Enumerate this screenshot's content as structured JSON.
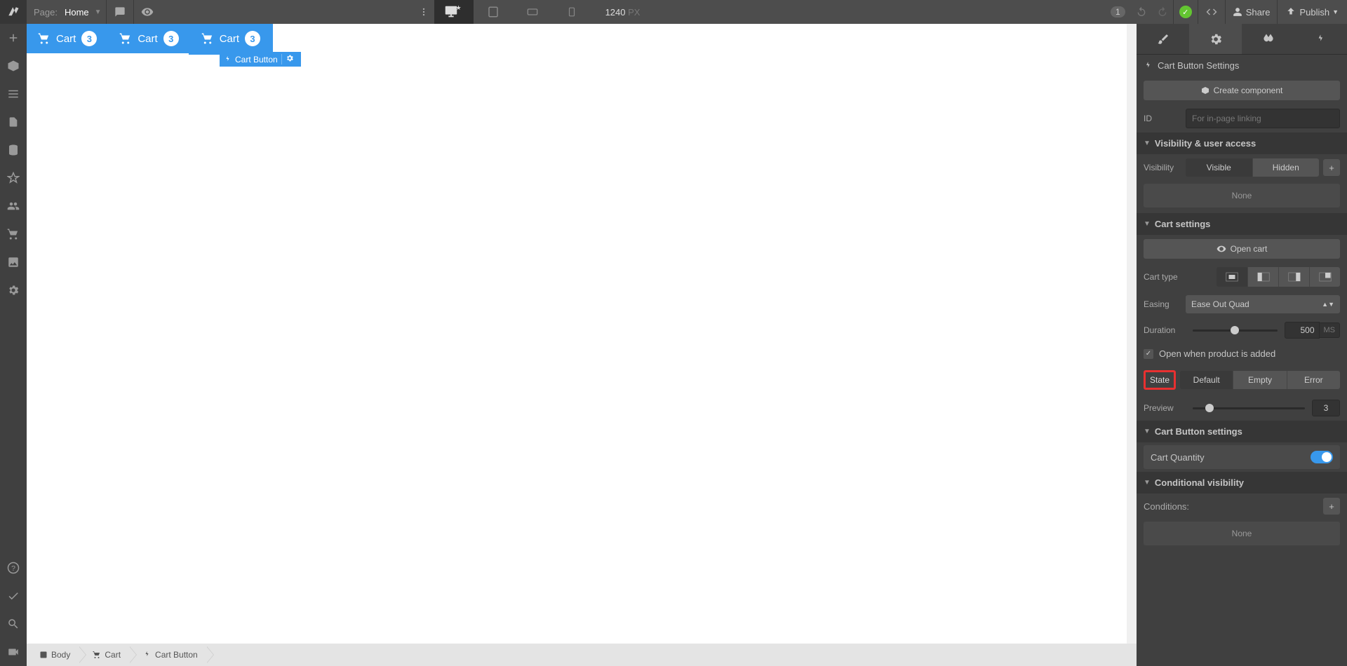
{
  "topbar": {
    "page_label": "Page:",
    "page_name": "Home",
    "viewport_num": "1240",
    "viewport_unit": "PX",
    "changes": "1",
    "share": "Share",
    "publish": "Publish"
  },
  "canvas": {
    "cart_label": "Cart",
    "cart_count": "3",
    "selection_label": "Cart Button"
  },
  "breadcrumb": {
    "body": "Body",
    "cart": "Cart",
    "cart_button": "Cart Button"
  },
  "panel": {
    "title": "Cart Button Settings",
    "create_component": "Create component",
    "id_label": "ID",
    "id_placeholder": "For in-page linking",
    "visibility_section": "Visibility & user access",
    "visibility_label": "Visibility",
    "visible": "Visible",
    "hidden": "Hidden",
    "none": "None",
    "cart_settings": "Cart settings",
    "open_cart": "Open cart",
    "cart_type_label": "Cart type",
    "easing_label": "Easing",
    "easing_value": "Ease Out Quad",
    "duration_label": "Duration",
    "duration_value": "500",
    "duration_unit": "MS",
    "open_when_added": "Open when product is added",
    "state_label": "State",
    "default": "Default",
    "empty": "Empty",
    "error": "Error",
    "preview_label": "Preview",
    "preview_value": "3",
    "cart_button_settings": "Cart Button settings",
    "cart_quantity": "Cart Quantity",
    "conditional_visibility": "Conditional visibility",
    "conditions": "Conditions:"
  }
}
